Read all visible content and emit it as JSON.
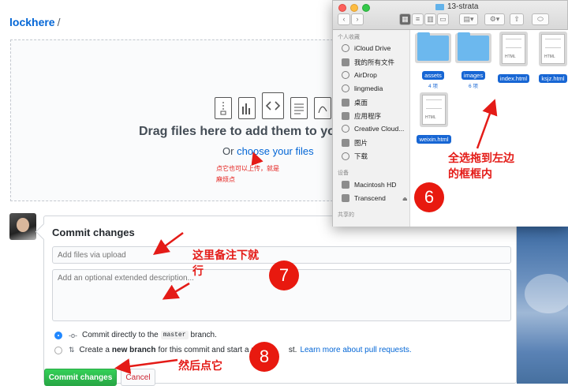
{
  "breadcrumb": {
    "owner": "lockhere",
    "sep": "/"
  },
  "dropzone": {
    "title": "Drag files here to add them to your",
    "or": "Or ",
    "choose_link": "choose your files"
  },
  "commit": {
    "title": "Commit changes",
    "summary_placeholder": "Add files via upload",
    "desc_placeholder": "Add an optional extended description...",
    "opt1_pre": "Commit directly to the",
    "opt1_code": "master",
    "opt1_post": "branch.",
    "opt2_pre": "Create a",
    "opt2_bold": "new branch",
    "opt2_mid": "for this commit and start a p",
    "opt2_tail": "st.",
    "opt2_link": "Learn more about pull requests.",
    "commit_btn": "Commit changes",
    "cancel_btn": "Cancel"
  },
  "finder": {
    "window_title": "13-strata",
    "sidebar_head1": "个人收藏",
    "favorites": [
      "iCloud Drive",
      "我的所有文件",
      "AirDrop",
      "lingmedia",
      "桌面",
      "应用程序",
      "Creative Cloud...",
      "图片",
      "下载"
    ],
    "sidebar_head2": "设备",
    "devices": [
      "Macintosh HD",
      "Transcend"
    ],
    "sidebar_head3": "共享的",
    "eject": "⏏",
    "items": [
      {
        "name": "assets",
        "count": "4 项"
      },
      {
        "name": "images",
        "count": "6 项"
      },
      {
        "name": "index.html",
        "tag": "HTML"
      },
      {
        "name": "ksjz.html",
        "tag": "HTML"
      },
      {
        "name": "weixin.html",
        "tag": "HTML"
      }
    ]
  },
  "annotations": {
    "note_upload": [
      "点它也可以上传，就是",
      "麻烦点"
    ],
    "note_drag": [
      "全选拖到左边",
      "的框框内"
    ],
    "note_remark": [
      "这里备注下就",
      "行"
    ],
    "note_click": "然后点它",
    "badges": [
      "6",
      "7",
      "8"
    ]
  },
  "colors": {
    "accent_green": "#28a745",
    "link_blue": "#0366d6",
    "annotation_red": "#e41b17",
    "finder_select": "#1766d4"
  }
}
